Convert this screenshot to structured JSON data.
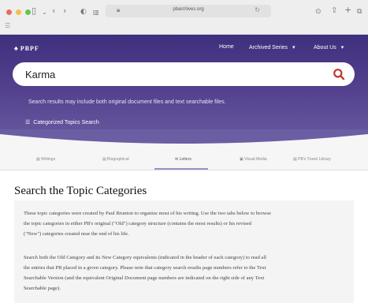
{
  "browser": {
    "url": "pbarchives.org"
  },
  "site": {
    "logo": "PBPF",
    "nav": {
      "home": "Home",
      "archived_series": "Archived Series",
      "about_us": "About Us"
    }
  },
  "search": {
    "value": "Karma",
    "hint": "Search results may include both original document files and text searchable files.",
    "categorized_link": "Categorized Topics Search"
  },
  "tabs": [
    {
      "label": "Writings",
      "active": false
    },
    {
      "label": "Biographical",
      "active": false
    },
    {
      "label": "Letters",
      "active": true
    },
    {
      "label": "Visual Media",
      "active": false
    },
    {
      "label": "PB's Travel Library",
      "active": false
    }
  ],
  "content": {
    "title": "Search the Topic Categories",
    "paragraph1": [
      "These topic categories were created by Paul Brunton to organize most of his writing. Use the two tabs below to browse",
      "the topic categories in either PB's original (\"Old\") category structure (contains the most results) or his revised",
      "(\"New\") categories created near the end of his life."
    ],
    "paragraph2": [
      "Search both the Old Category and its New Category equivalents (indicated in the header of each category) to read all",
      "the entries that PB placed in a given category. Please note that category search results page numbers refer to the Text",
      "Searchable Version (and the equivalent Original Document page numbers are indicated on the right side of any Text",
      "Searchable page)."
    ]
  },
  "colors": {
    "hero_top": "#3f2f7c",
    "hero_bottom": "#6b5ea3",
    "search_icon": "#c0392b",
    "active_tab_bar": "#9f90c9"
  }
}
